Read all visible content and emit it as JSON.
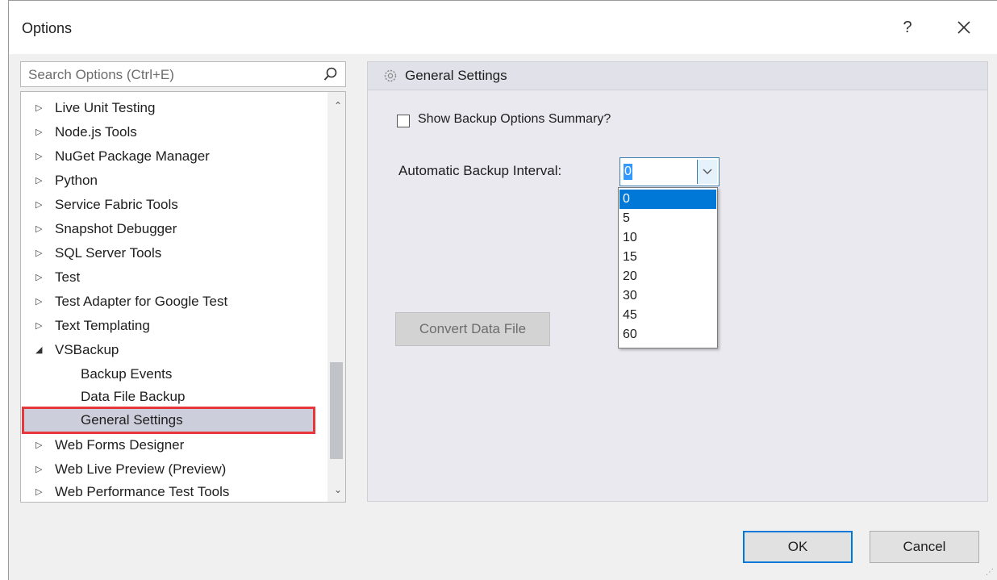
{
  "window": {
    "title": "Options",
    "help_glyph": "?"
  },
  "search": {
    "placeholder": "Search Options (Ctrl+E)"
  },
  "tree": {
    "items": [
      {
        "label": "Live Unit Testing",
        "arrow": "▷"
      },
      {
        "label": "Node.js Tools",
        "arrow": "▷"
      },
      {
        "label": "NuGet Package Manager",
        "arrow": "▷"
      },
      {
        "label": "Python",
        "arrow": "▷"
      },
      {
        "label": "Service Fabric Tools",
        "arrow": "▷"
      },
      {
        "label": "Snapshot Debugger",
        "arrow": "▷"
      },
      {
        "label": "SQL Server Tools",
        "arrow": "▷"
      },
      {
        "label": "Test",
        "arrow": "▷"
      },
      {
        "label": "Test Adapter for Google Test",
        "arrow": "▷"
      },
      {
        "label": "Text Templating",
        "arrow": "▷"
      },
      {
        "label": "VSBackup",
        "arrow": "◢"
      },
      {
        "label": "Backup Events"
      },
      {
        "label": "Data File Backup"
      },
      {
        "label": "General Settings"
      },
      {
        "label": "Web Forms Designer",
        "arrow": "▷"
      },
      {
        "label": "Web Live Preview (Preview)",
        "arrow": "▷"
      },
      {
        "label": "Web Performance Test Tools",
        "arrow": "▷"
      }
    ],
    "scroll_up": "⌃",
    "scroll_down": "⌄"
  },
  "panel": {
    "header": "General Settings",
    "show_summary_label": "Show Backup Options Summary?",
    "interval_label": "Automatic Backup Interval:",
    "interval_value": "0",
    "interval_options": [
      "0",
      "5",
      "10",
      "15",
      "20",
      "30",
      "45",
      "60"
    ],
    "convert_label": "Convert Data File"
  },
  "footer": {
    "ok_label": "OK",
    "cancel_label": "Cancel"
  }
}
